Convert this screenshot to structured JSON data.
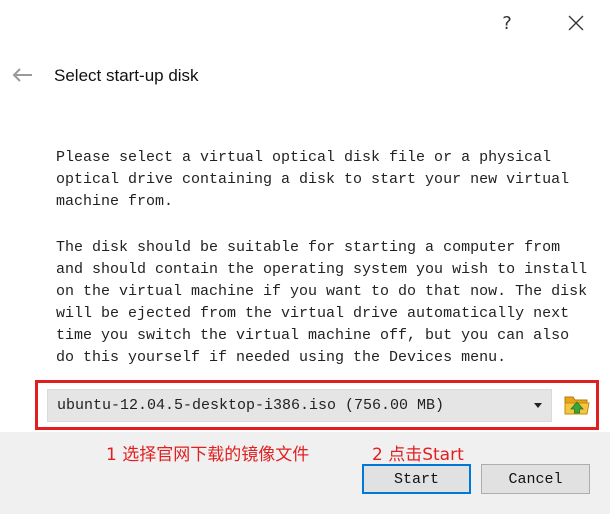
{
  "dialog": {
    "title": "Select start-up disk",
    "help_glyph": "?",
    "description_1": "Please select a virtual optical disk file or a physical\noptical drive containing a disk to start your new virtual\nmachine from.",
    "description_2": "The disk should be suitable for starting a computer from\nand should contain the operating system you wish to install\non the virtual machine if you want to do that now. The disk\nwill be ejected from the virtual drive automatically next\ntime you switch the virtual machine off, but you can also\ndo this yourself if needed using the Devices menu."
  },
  "disk_select": {
    "selected": "ubuntu-12.04.5-desktop-i386.iso (756.00 MB)"
  },
  "annotations": {
    "step1": "1 选择官网下载的镜像文件",
    "step2": "2 点击Start",
    "color": "#e02020"
  },
  "buttons": {
    "start": "Start",
    "cancel": "Cancel"
  },
  "colors": {
    "footer_bg": "#f0f0f0",
    "default_button_border": "#0078d7",
    "folder_icon": "#f5b921",
    "folder_arrow": "#3aa53a"
  }
}
